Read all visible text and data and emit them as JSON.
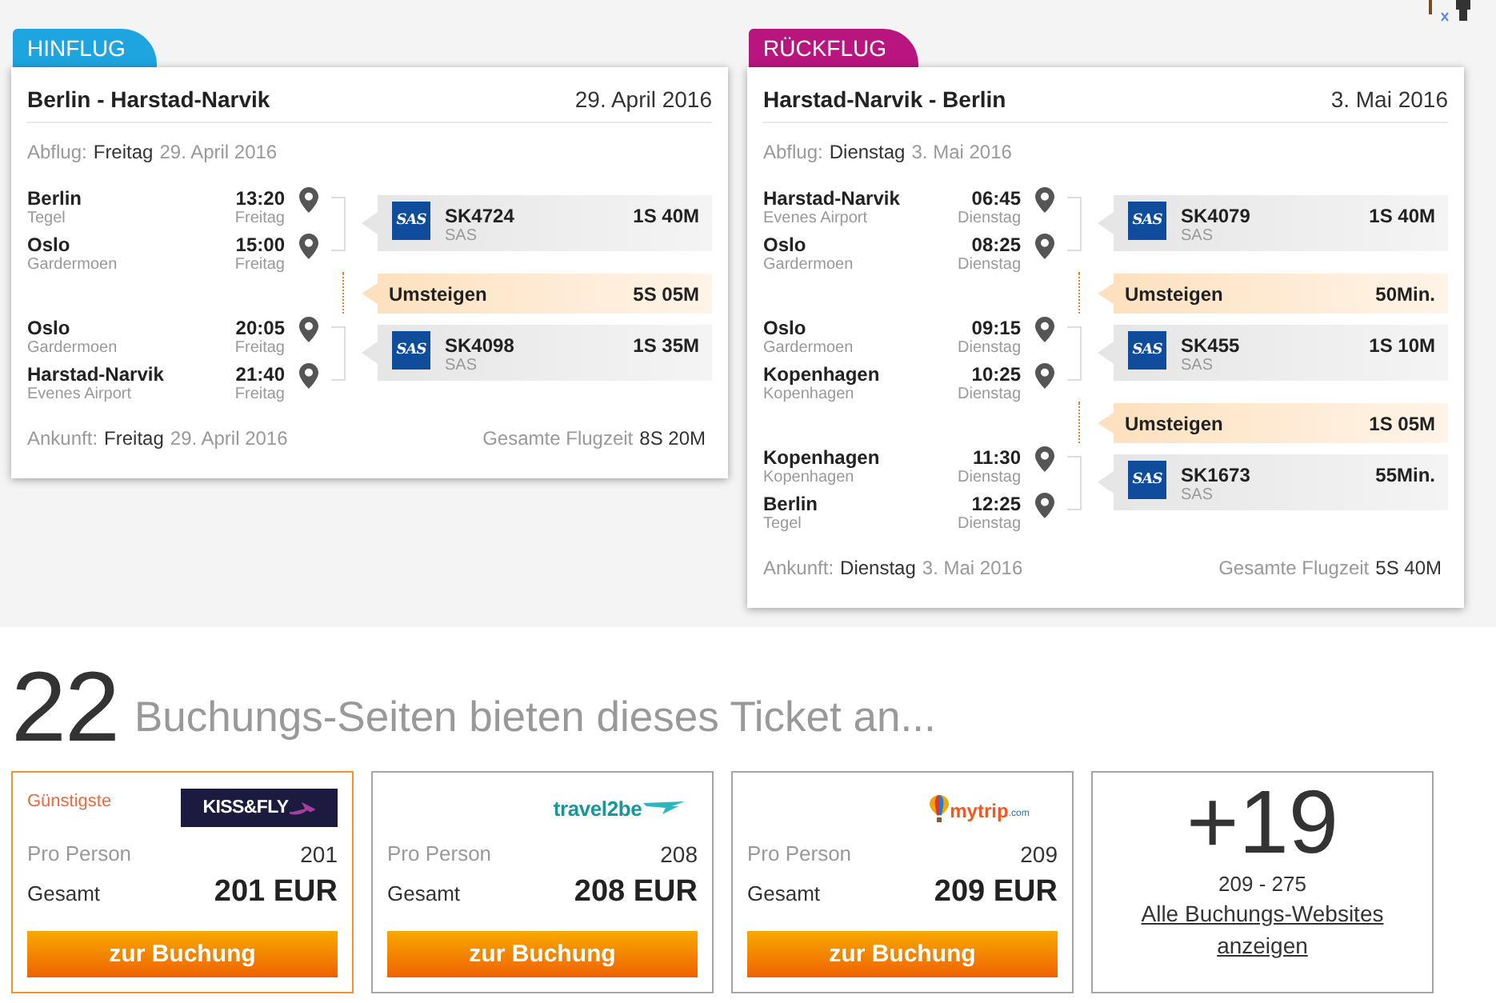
{
  "legs": [
    {
      "tab": "HINFLUG",
      "color": "#1ea4df",
      "route": "Berlin - Harstad-Narvik",
      "date": "29. April 2016",
      "departure": {
        "label": "Abflug:",
        "day": "Freitag",
        "date": "29. April 2016"
      },
      "items": [
        {
          "kind": "flight",
          "stops": [
            {
              "city": "Berlin",
              "airport": "Tegel",
              "time": "13:20",
              "day": "Freitag"
            },
            {
              "city": "Oslo",
              "airport": "Gardermoen",
              "time": "15:00",
              "day": "Freitag"
            }
          ],
          "logo": "SAS",
          "code": "SK4724",
          "airline": "SAS",
          "duration": "1S 40M"
        },
        {
          "kind": "connection",
          "label": "Umsteigen",
          "duration": "5S 05M"
        },
        {
          "kind": "flight",
          "stops": [
            {
              "city": "Oslo",
              "airport": "Gardermoen",
              "time": "20:05",
              "day": "Freitag"
            },
            {
              "city": "Harstad-Narvik",
              "airport": "Evenes Airport",
              "time": "21:40",
              "day": "Freitag"
            }
          ],
          "logo": "SAS",
          "code": "SK4098",
          "airline": "SAS",
          "duration": "1S 35M"
        }
      ],
      "arrival": {
        "label": "Ankunft:",
        "day": "Freitag",
        "date": "29. April 2016"
      },
      "total": {
        "label": "Gesamte Flugzeit",
        "duration": "8S 20M"
      }
    },
    {
      "tab": "RÜCKFLUG",
      "color": "#b8157f",
      "route": "Harstad-Narvik - Berlin",
      "date": "3. Mai 2016",
      "departure": {
        "label": "Abflug:",
        "day": "Dienstag",
        "date": "3. Mai 2016"
      },
      "items": [
        {
          "kind": "flight",
          "stops": [
            {
              "city": "Harstad-Narvik",
              "airport": "Evenes Airport",
              "time": "06:45",
              "day": "Dienstag"
            },
            {
              "city": "Oslo",
              "airport": "Gardermoen",
              "time": "08:25",
              "day": "Dienstag"
            }
          ],
          "logo": "SAS",
          "code": "SK4079",
          "airline": "SAS",
          "duration": "1S 40M"
        },
        {
          "kind": "connection",
          "label": "Umsteigen",
          "duration": "50Min."
        },
        {
          "kind": "flight",
          "stops": [
            {
              "city": "Oslo",
              "airport": "Gardermoen",
              "time": "09:15",
              "day": "Dienstag"
            },
            {
              "city": "Kopenhagen",
              "airport": "Kopenhagen",
              "time": "10:25",
              "day": "Dienstag"
            }
          ],
          "logo": "SAS",
          "code": "SK455",
          "airline": "SAS",
          "duration": "1S 10M"
        },
        {
          "kind": "connection",
          "label": "Umsteigen",
          "duration": "1S 05M"
        },
        {
          "kind": "flight",
          "stops": [
            {
              "city": "Kopenhagen",
              "airport": "Kopenhagen",
              "time": "11:30",
              "day": "Dienstag"
            },
            {
              "city": "Berlin",
              "airport": "Tegel",
              "time": "12:25",
              "day": "Dienstag"
            }
          ],
          "logo": "SAS",
          "code": "SK1673",
          "airline": "SAS",
          "duration": "55Min."
        }
      ],
      "arrival": {
        "label": "Ankunft:",
        "day": "Dienstag",
        "date": "3. Mai 2016"
      },
      "total": {
        "label": "Gesamte Flugzeit",
        "duration": "5S 40M"
      }
    }
  ],
  "heading": {
    "count": "22",
    "text": "Buchungs-Seiten bieten dieses Ticket an..."
  },
  "offers": [
    {
      "cheapest": true,
      "badge": "Günstigste",
      "logo": {
        "kind": "dark-banner",
        "text": "KISS&FLY"
      },
      "per_person_label": "Pro Person",
      "per_person": "201",
      "total_label": "Gesamt",
      "total": "201 EUR",
      "button": "zur Buchung"
    },
    {
      "cheapest": false,
      "logo": {
        "kind": "swoosh",
        "text": "travel2be"
      },
      "per_person_label": "Pro Person",
      "per_person": "208",
      "total_label": "Gesamt",
      "total": "208 EUR",
      "button": "zur Buchung"
    },
    {
      "cheapest": false,
      "logo": {
        "kind": "balloon",
        "text": "mytrip",
        "suffix": ".com"
      },
      "per_person_label": "Pro Person",
      "per_person": "209",
      "total_label": "Gesamt",
      "total": "209 EUR",
      "button": "zur Buchung"
    }
  ],
  "more": {
    "count": "+19",
    "range": "209 - 275",
    "link": "Alle Buchungs-Websites anzeigen"
  }
}
